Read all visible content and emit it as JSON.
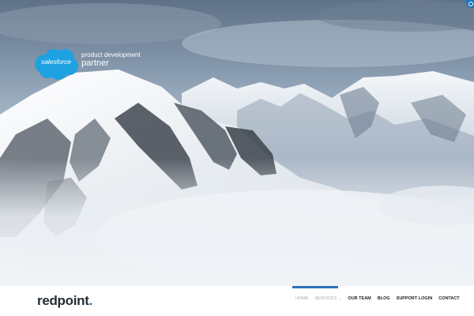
{
  "hero": {
    "badge": {
      "brand": "salesforce",
      "line1": "product development",
      "line2": "partner"
    },
    "corner_icon": "settings-icon"
  },
  "navbar": {
    "logo_text": "redpoint",
    "logo_dot": ".",
    "items": [
      {
        "label": "HOME",
        "active": false
      },
      {
        "label": "SERVICES",
        "active": true,
        "has_dropdown": true
      },
      {
        "label": "OUR TEAM"
      },
      {
        "label": "BLOG"
      },
      {
        "label": "SUPPORT LOGIN"
      },
      {
        "label": "CONTACT"
      }
    ],
    "dropdown_icon": "chevron-down-icon"
  },
  "colors": {
    "accent": "#1b75bc",
    "logo_text": "#242c36",
    "active_bar": "#2f6fba"
  }
}
